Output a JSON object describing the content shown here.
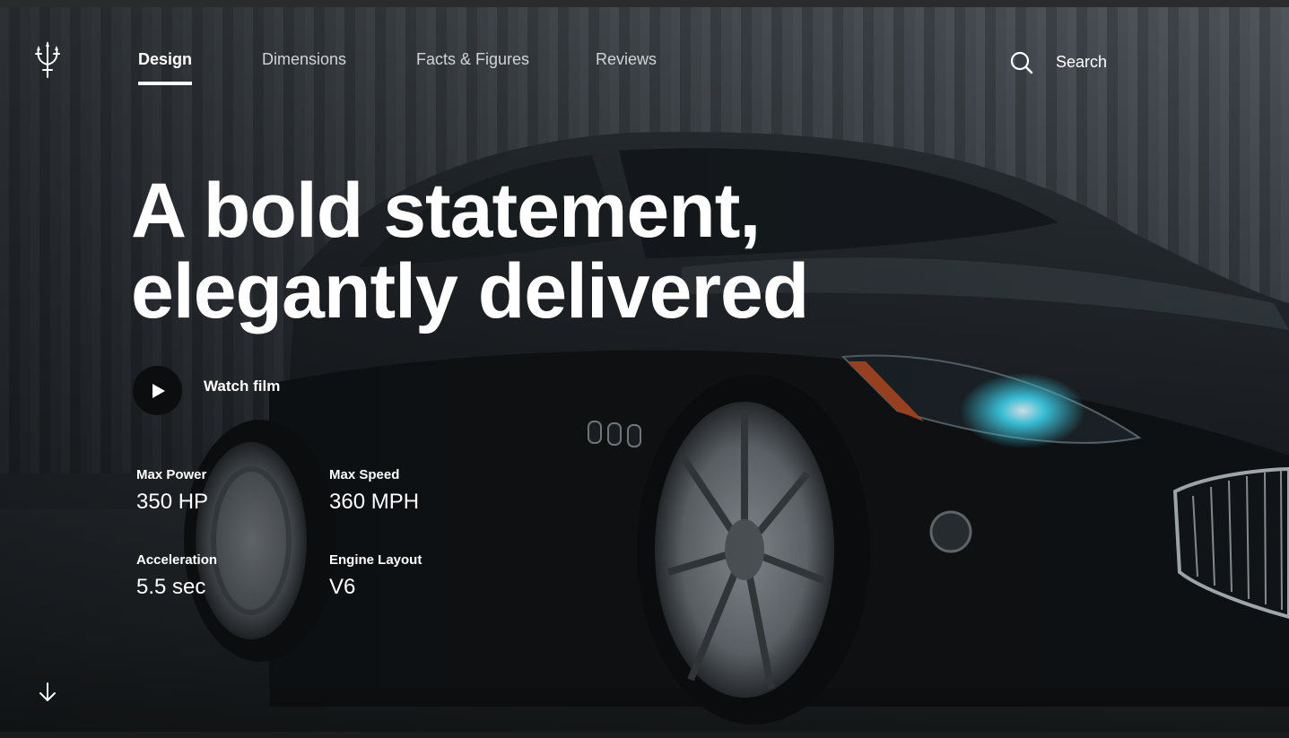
{
  "brand": {
    "logo_icon": "trident-logo-icon"
  },
  "nav": {
    "items": [
      {
        "label": "Design",
        "active": true
      },
      {
        "label": "Dimensions",
        "active": false
      },
      {
        "label": "Facts & Figures",
        "active": false
      },
      {
        "label": "Reviews",
        "active": false
      }
    ]
  },
  "search": {
    "label": "Search",
    "icon": "search-icon"
  },
  "hero": {
    "headline_line1": "A bold statement,",
    "headline_line2": "elegantly delivered",
    "cta_label": "Watch film",
    "cta_icon": "play-icon"
  },
  "specs": [
    {
      "label": "Max Power",
      "value": "350 HP"
    },
    {
      "label": "Max Speed",
      "value": "360 MPH"
    },
    {
      "label": "Acceleration",
      "value": "5.5 sec"
    },
    {
      "label": "Engine Layout",
      "value": "V6"
    }
  ],
  "scroll": {
    "icon": "arrow-down-icon"
  },
  "colors": {
    "text": "#ffffff",
    "nav_inactive": "#d0d4d8",
    "headlight": "#3fd6f0",
    "play_bg": "#0c0d0e"
  }
}
